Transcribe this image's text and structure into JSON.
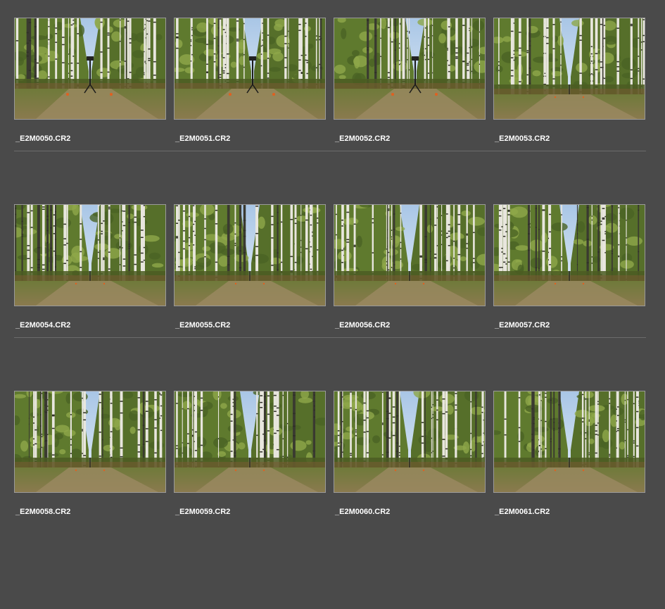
{
  "browser": {
    "colors": {
      "background": "#4a4a4a",
      "filename_text": "#ffffff",
      "thumb_border": "#9a9a9a",
      "divider": "#6c6c6c"
    },
    "rows": [
      {
        "items": [
          {
            "filename": "_E2M0050.CR2",
            "scene": "birch-path-tripod"
          },
          {
            "filename": "_E2M0051.CR2",
            "scene": "birch-path-tripod"
          },
          {
            "filename": "_E2M0052.CR2",
            "scene": "birch-path-tripod"
          },
          {
            "filename": "_E2M0053.CR2",
            "scene": "birch-path-wide"
          }
        ]
      },
      {
        "items": [
          {
            "filename": "_E2M0054.CR2",
            "scene": "birch-path-wide"
          },
          {
            "filename": "_E2M0055.CR2",
            "scene": "birch-path-wide"
          },
          {
            "filename": "_E2M0056.CR2",
            "scene": "birch-path-wide"
          },
          {
            "filename": "_E2M0057.CR2",
            "scene": "birch-path-wide"
          }
        ]
      },
      {
        "items": [
          {
            "filename": "_E2M0058.CR2",
            "scene": "birch-path-wide"
          },
          {
            "filename": "_E2M0059.CR2",
            "scene": "birch-path-wide"
          },
          {
            "filename": "_E2M0060.CR2",
            "scene": "birch-path-wide"
          },
          {
            "filename": "_E2M0061.CR2",
            "scene": "birch-path-wide"
          }
        ]
      }
    ]
  }
}
